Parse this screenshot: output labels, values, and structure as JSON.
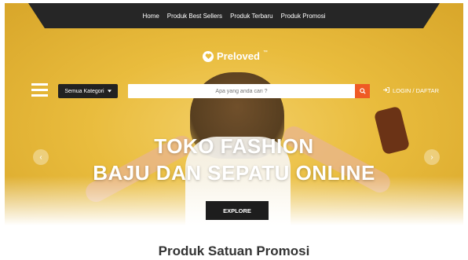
{
  "topnav": {
    "items": [
      "Home",
      "Produk Best Sellers",
      "Produk Terbaru",
      "Produk Promosi"
    ]
  },
  "brand": {
    "name": "Preloved",
    "trademark": "™"
  },
  "header": {
    "menu_icon": "hamburger-menu-icon",
    "category_label": "Semua Kategori",
    "search_placeholder": "Apa yang anda cari ?",
    "search_icon": "search-icon",
    "login_label": "LOGIN / DAFTAR",
    "login_icon": "sign-in-icon"
  },
  "hero": {
    "line1": "TOKO FASHION",
    "line2": "BAJU DAN SEPATU ONLINE",
    "cta_label": "EXPLORE",
    "prev_icon": "chevron-left-icon",
    "next_icon": "chevron-right-icon"
  },
  "section": {
    "title": "Produk Satuan Promosi"
  },
  "colors": {
    "hero_yellow": "#e9bc3d",
    "nav_dark": "#262626",
    "search_button": "#ef5a24",
    "cta_dark": "#1d1d1d"
  }
}
